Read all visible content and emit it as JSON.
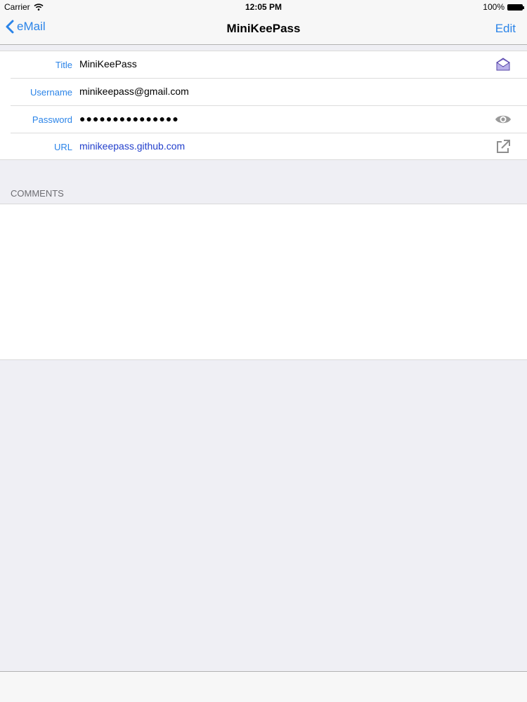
{
  "status_bar": {
    "carrier": "Carrier",
    "time": "12:05 PM",
    "battery": "100%"
  },
  "nav": {
    "back_label": "eMail",
    "title": "MiniKeePass",
    "edit_label": "Edit"
  },
  "fields": [
    {
      "label": "Title",
      "value": "MiniKeePass",
      "icon": "envelope-icon"
    },
    {
      "label": "Username",
      "value": "minikeepass@gmail.com"
    },
    {
      "label": "Password",
      "value": "●●●●●●●●●●●●●●●",
      "icon": "eye-icon"
    },
    {
      "label": "URL",
      "value": "minikeepass.github.com",
      "icon": "external-link-icon"
    }
  ],
  "comments": {
    "header": "COMMENTS",
    "text": ""
  },
  "colors": {
    "accent": "#2b84e8",
    "link": "#2340cc",
    "background": "#efeff4"
  }
}
